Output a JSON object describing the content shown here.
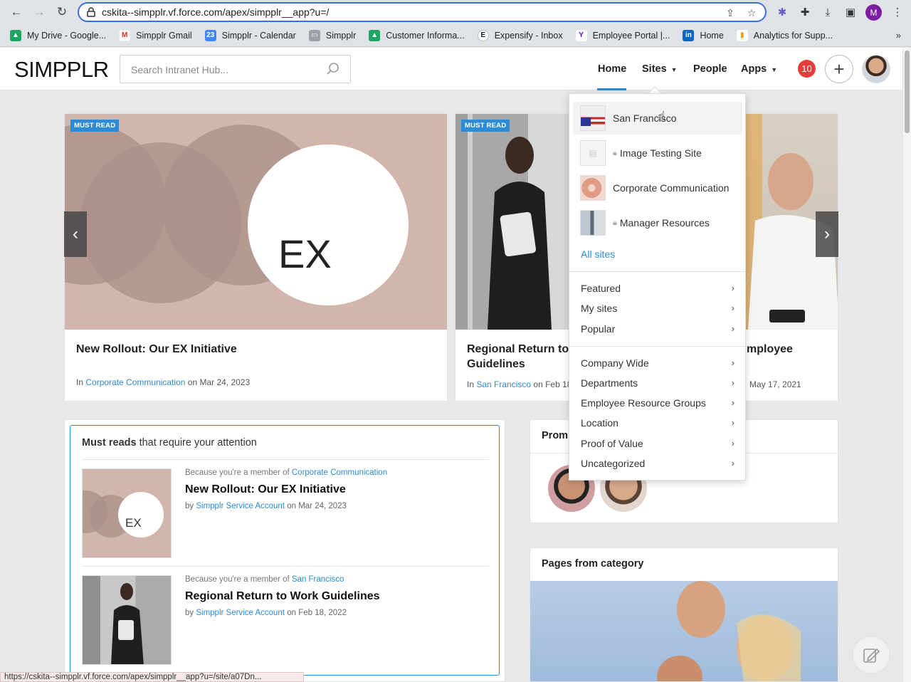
{
  "browser": {
    "url": "cskita--simpplr.vf.force.com/apex/simpplr__app?u=/",
    "profile_initial": "M",
    "bookmarks": [
      {
        "label": "My Drive - Google...",
        "icon": "google-drive-icon",
        "color": "#1fa463"
      },
      {
        "label": "Simpplr Gmail",
        "icon": "gmail-icon",
        "color": "#d93025"
      },
      {
        "label": "Simpplr - Calendar",
        "icon": "google-calendar-icon",
        "color": "#4285f4"
      },
      {
        "label": "Simpplr",
        "icon": "folder-icon",
        "color": "#777777"
      },
      {
        "label": "Customer Informa...",
        "icon": "google-drive-icon",
        "color": "#1fa463"
      },
      {
        "label": "Expensify - Inbox",
        "icon": "expensify-icon",
        "color": "#0b1f3a"
      },
      {
        "label": "Employee Portal |...",
        "icon": "yahoo-icon",
        "color": "#5f01d1"
      },
      {
        "label": "Home",
        "icon": "linkedin-icon",
        "color": "#0a66c2"
      },
      {
        "label": "Analytics for Supp...",
        "icon": "analytics-icon",
        "color": "#f29900"
      }
    ],
    "more_label": "»",
    "status_url": "https://cskita--simpplr.vf.force.com/apex/simpplr__app?u=/site/a07Dn..."
  },
  "header": {
    "logo": "SIMPPLR",
    "search_placeholder": "Search Intranet Hub...",
    "nav": {
      "home": "Home",
      "sites": "Sites",
      "people": "People",
      "apps": "Apps"
    },
    "notification_count": "10"
  },
  "carousel": {
    "must_read_label": "MUST READ",
    "cards": [
      {
        "title": "New Rollout: Our EX Initiative",
        "in_label": "In",
        "site": "Corporate Communication",
        "date_text": "on Mar 24, 2023",
        "image_text": "EX"
      },
      {
        "title": "Regional Return to W Guidelines",
        "title_line1": "Regional Return to W",
        "title_line2": "Guidelines",
        "in_label": "In",
        "site": "San Francisco",
        "date_text": "on Feb 18"
      },
      {
        "title_partial": "mployee",
        "date_text": "May 17, 2021"
      }
    ]
  },
  "must_reads": {
    "heading_bold": "Must reads",
    "heading_rest": " that require your attention",
    "items": [
      {
        "because": "Because you're a member of",
        "site": "Corporate Communication",
        "title": "New Rollout: Our EX Initiative",
        "by": "by",
        "author": "Simpplr Service Account",
        "date": "on Mar 24, 2023",
        "image_text": "EX"
      },
      {
        "because": "Because you're a member of",
        "site": "San Francisco",
        "title": "Regional Return to Work Guidelines",
        "by": "by",
        "author": "Simpplr Service Account",
        "date": "on Feb 18, 2022"
      }
    ]
  },
  "widgets": {
    "promoted_partial": "Prom",
    "pages_from_category": "Pages from category"
  },
  "sites_dropdown": {
    "sites": [
      {
        "name": "San Francisco",
        "locked": false
      },
      {
        "name": "Image Testing Site",
        "locked": true
      },
      {
        "name": "Corporate Communication",
        "locked": false
      },
      {
        "name": "Manager Resources",
        "locked": true
      }
    ],
    "all_sites": "All sites",
    "group1": [
      "Featured",
      "My sites",
      "Popular"
    ],
    "group2": [
      "Company Wide",
      "Departments",
      "Employee Resource Groups",
      "Location",
      "Proof of Value",
      "Uncategorized"
    ]
  },
  "colors": {
    "accent": "#2c8bd6",
    "badge": "#e63c3c",
    "must_read_bg": "#2c8bd6"
  }
}
